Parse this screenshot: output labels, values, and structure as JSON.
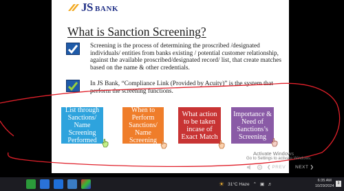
{
  "slide": {
    "logo": {
      "brand": "JS",
      "suffix": "BANK"
    },
    "title": "What is Sanction Screening?",
    "bullets": [
      {
        "text": "Screening is the process of determining the proscribed /designated individuals/ entities from banks existing / potential customer relationship, against the available proscribed/designated record/ list, that create matches based on the name & other credentials."
      },
      {
        "text": "In JS Bank, “Compliance Link (Provided by Acuity)” is the system that perform the screening functions."
      }
    ],
    "boxes": [
      {
        "label": "List through Sanctions/ Name Screening Performed",
        "color": "#2ea3dd"
      },
      {
        "label": "When to Perform Sanctions/ Name Screening",
        "color": "#ef7d2a"
      },
      {
        "label": "What action to be taken incase of Exact Match",
        "color": "#c83434"
      },
      {
        "label": "Importance & Need of Sanctions’s Screening",
        "color": "#8a5aa6"
      }
    ]
  },
  "watermark": {
    "line1": "Activate Windows",
    "line2": "Go to Settings to activate Windows."
  },
  "player": {
    "prev_label": "PREV",
    "next_label": "NEXT"
  },
  "taskbar": {
    "weather": "31°C  Haze",
    "time": "6:35 AM",
    "date": "10/29/2024",
    "notifications": "3"
  },
  "annotation_color": "#e0202a"
}
